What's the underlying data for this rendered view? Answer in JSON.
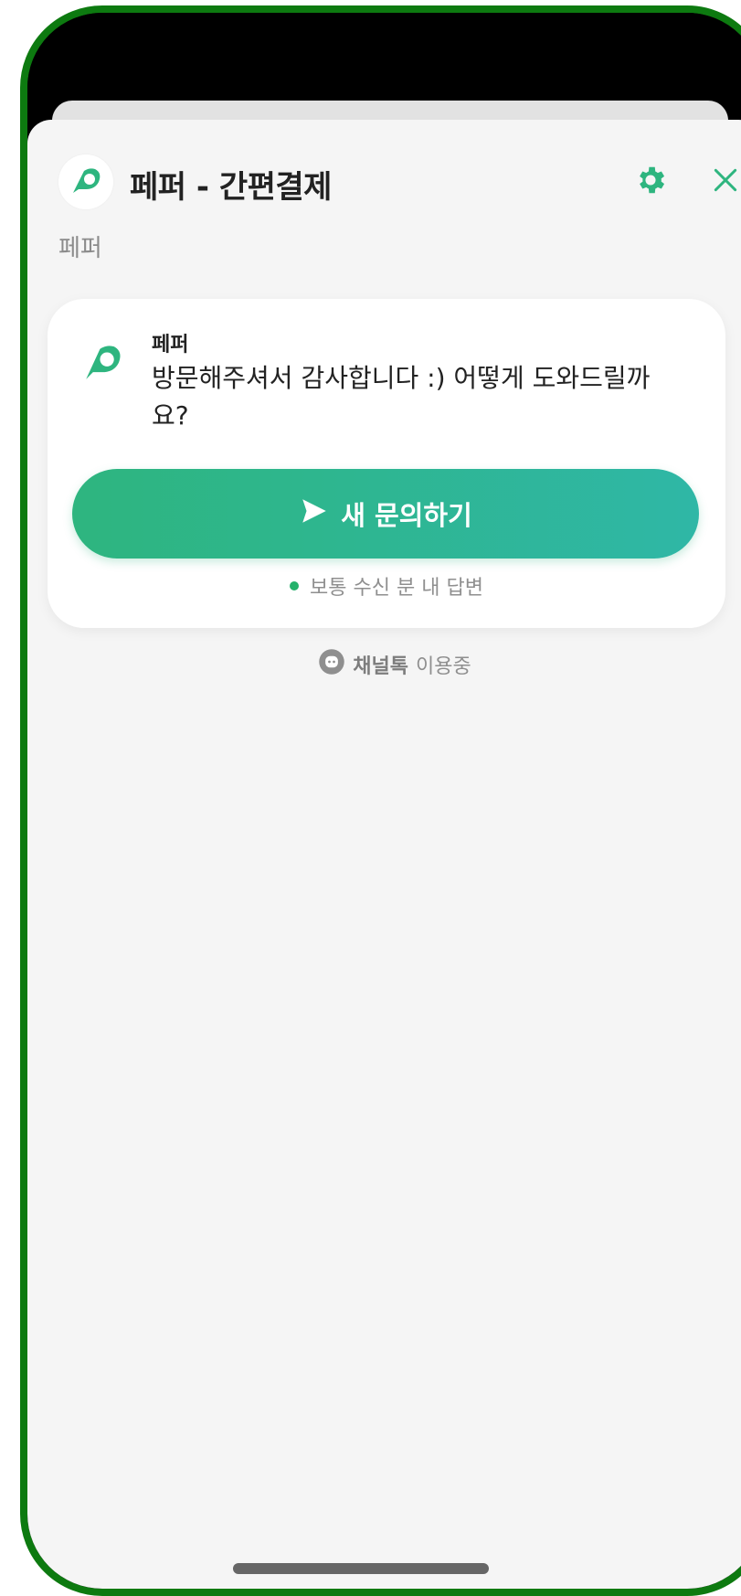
{
  "app": {
    "title": "페퍼 - 간편결제",
    "subtitle": "페퍼"
  },
  "message": {
    "sender": "페퍼",
    "text": "방문해주셔서 감사합니다 :) 어떻게 도와드릴까요?"
  },
  "cta": {
    "label": "새 문의하기",
    "icon": "send-icon"
  },
  "status": {
    "text": "보통 수신 분 내 답변"
  },
  "powered": {
    "brand": "채널톡",
    "suffix": "이용중"
  },
  "icons": {
    "app_logo": "pepper-logo-icon",
    "settings": "gear-icon",
    "close": "close-icon",
    "channel": "channeltalk-icon"
  },
  "colors": {
    "accent": "#2eb57f",
    "accent_end": "#2fb7a6",
    "status_dot": "#24b26b",
    "frame": "#0d7a10",
    "sheet_bg": "#f5f5f5"
  }
}
